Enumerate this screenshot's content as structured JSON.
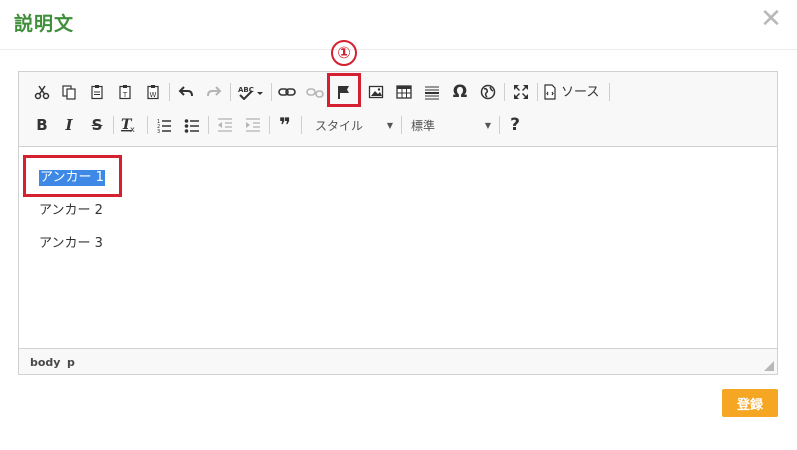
{
  "dialog": {
    "title": "説明文",
    "close_glyph": "✕"
  },
  "annotation": {
    "marker": "①",
    "color": "#d42030"
  },
  "toolbar": {
    "row1": [
      "cut-icon",
      "copy-icon",
      "paste-icon",
      "paste-text-icon",
      "paste-word-icon",
      "undo-icon",
      "redo-icon",
      "spellcheck-icon",
      "link-icon",
      "unlink-icon",
      "anchor-icon",
      "image-icon",
      "table-icon",
      "horizontal-line-icon",
      "special-char-icon",
      "iframe-icon",
      "maximize-icon",
      "source-icon"
    ],
    "source_label": "ソース",
    "bold": "B",
    "italic": "I",
    "strike": "S",
    "remove_format": "Tx",
    "blockquote": "❞",
    "help": "?",
    "style_combo": "スタイル",
    "format_combo": "標準"
  },
  "content": {
    "lines": [
      "アンカー 1",
      "アンカー 2",
      "アンカー 3"
    ],
    "selected_index": 0
  },
  "statusbar": {
    "path": [
      "body",
      "p"
    ]
  },
  "actions": {
    "register_label": "登録"
  },
  "colors": {
    "title": "#3f8f3a",
    "selection": "#3f89e6",
    "register_button": "#f5a623",
    "highlight": "#d42030"
  }
}
